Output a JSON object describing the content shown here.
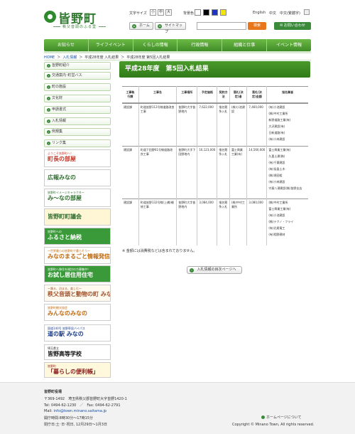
{
  "header": {
    "logo_title": "皆野町",
    "logo_subtitle": "秩父音頭のふる里",
    "font_size_label": "文字サイズ",
    "font_sizes": [
      "小",
      "中",
      "大"
    ],
    "bg_color_label": "背景色",
    "bg_colors": [
      "#ffffff",
      "#000000",
      "#1d32c8",
      "#f5e600"
    ],
    "languages": [
      "English",
      "中文",
      "中文(繁體字)"
    ],
    "home_button": "ホーム",
    "sitemap_button": "サイトマップ",
    "search_placeholder": "",
    "search_button": "検索",
    "contact_button": "お問い合わせ"
  },
  "nav": [
    "お知らせ",
    "ライフイベント",
    "くらしの情報",
    "行政情報",
    "組織と仕事",
    "イベント情報"
  ],
  "breadcrumb": [
    "HOME",
    "入札情報",
    "平成28年度 入札結果",
    "平成28年度 第5回入札結果"
  ],
  "sidebar": {
    "items": [
      "皆野町紹介",
      "交通案内･町営バス",
      "町の施設",
      "文化財",
      "申請書式",
      "入札情報",
      "例規集",
      "リンク集"
    ],
    "banners": [
      {
        "title": "町長の部屋",
        "sub": "ようこそ皆野町へ！",
        "color": "#c0392b",
        "bg": "#ffffff"
      },
      {
        "title": "広報みなの",
        "sub": "",
        "color": "#2f6f2f",
        "bg": "#ffffff"
      },
      {
        "title": "み～なの部屋",
        "sub": "皆野町イメージキャラクター",
        "color": "#2f6f2f",
        "bg": "#ffffff"
      },
      {
        "title": "皆野町町議会",
        "sub": "",
        "color": "#2f6f2f",
        "bg": "#fff6d6"
      },
      {
        "title": "ふるさと納税",
        "sub": "皆野町への",
        "color": "#ffffff",
        "bg": "#3a9a3a"
      },
      {
        "title": "みなのまるごと情報発信",
        "sub": "～世界最小の皆野町で暮らそう～",
        "color": "#c06a10",
        "bg": "#ffffff"
      },
      {
        "title": "お試し居住用住宅",
        "sub": "皆野町へ移住を検討の方募集中！",
        "color": "#ffffff",
        "bg": "#3a9a3a"
      },
      {
        "title": "秩父音頭と動物の町 みなの",
        "sub": "～踊る、泊まる、楽しむ～",
        "color": "#a0522d",
        "bg": "#fffaf0"
      },
      {
        "title": "みんなのみなの",
        "sub": "皆野町観光協会",
        "color": "#c06a10",
        "bg": "#ffffff"
      },
      {
        "title": "道の駅 みなの",
        "sub": "国道140号 皆野寄居バイパス",
        "color": "#1a3a8a",
        "bg": "#ffffff"
      },
      {
        "title": "皆野高等学校",
        "sub": "埼玉県立",
        "color": "#111111",
        "bg": "#ffffff"
      },
      {
        "title": "「暮らしの便利帳」",
        "sub": "皆野町",
        "color": "#8a1a1a",
        "bg": "#fff8dc"
      }
    ]
  },
  "main": {
    "title": "平成28年度　第5回入札結果",
    "table_headers": [
      "工事執\n行課",
      "工事名",
      "工事場所",
      "予定価格",
      "契約方\n法",
      "落札(決\n定)者",
      "落札(決\n定)金額",
      "指名業者"
    ],
    "rows": [
      {
        "dept": "建設課",
        "name": "町道皆野112号線道路改良工事",
        "place": "皆野町大字皆野地内",
        "price": "7,622,000",
        "method": "指名競争入札",
        "winner": "(株)小池建設",
        "amount": "7,460,000",
        "bidders": [
          "(有)小池建設",
          "(株)中村工業所",
          "新野道路工業(有)",
          "大沢建設(有)",
          "日新道路(有)",
          "(有)小林建設"
        ]
      },
      {
        "dept": "建設課",
        "name": "町道下田野61号線道路改良工事",
        "place": "皆野町大字下田野地内",
        "price": "16,123,000",
        "method": "指名競争入札",
        "winner": "富士興業工業(有)",
        "amount": "14,560,000",
        "bidders": [
          "富士興業工業(有)",
          "久喜土建(株)",
          "(有)千葉建設",
          "(有)長島土木",
          "(株)堀田組",
          "(有)小林建設",
          "守屋八潮建設(株)皆野支店"
        ]
      },
      {
        "dept": "建設課",
        "name": "町道皆野132号線(上橋)補修工事",
        "place": "皆野町大字皆野地内",
        "price": "3,084,000",
        "method": "指名競争入札",
        "winner": "(株)中村工業所",
        "amount": "3,080,000",
        "bidders": [
          "(株)中村工業所",
          "富士興業工業(有)",
          "(有)小池建設",
          "(株)テクノ・フライ",
          "(有)北尾電工",
          "(有)相野建材"
        ]
      }
    ],
    "note": "※ 金額には消費税などは含まれておりません。",
    "back_button": "入札情報の目次ページへ"
  },
  "footer": {
    "name": "皆野町役場",
    "address": "〒369-1492　埼玉県秩父郡皆野町大字皆野1420-1",
    "phone": "Tel: 0494-62-1230　／　Fax: 0494-62-2791",
    "mail_label": "Mail: ",
    "mail": "info@town.minano.saitama.jp",
    "hours": "開庁時間:8時30分～17時15分",
    "closed": "閉庁日:土･日･祝日, 12月29日～1月3日",
    "about_link": "ホームページについて",
    "copyright": "Copyright © Minano Town, All rights reserved."
  }
}
